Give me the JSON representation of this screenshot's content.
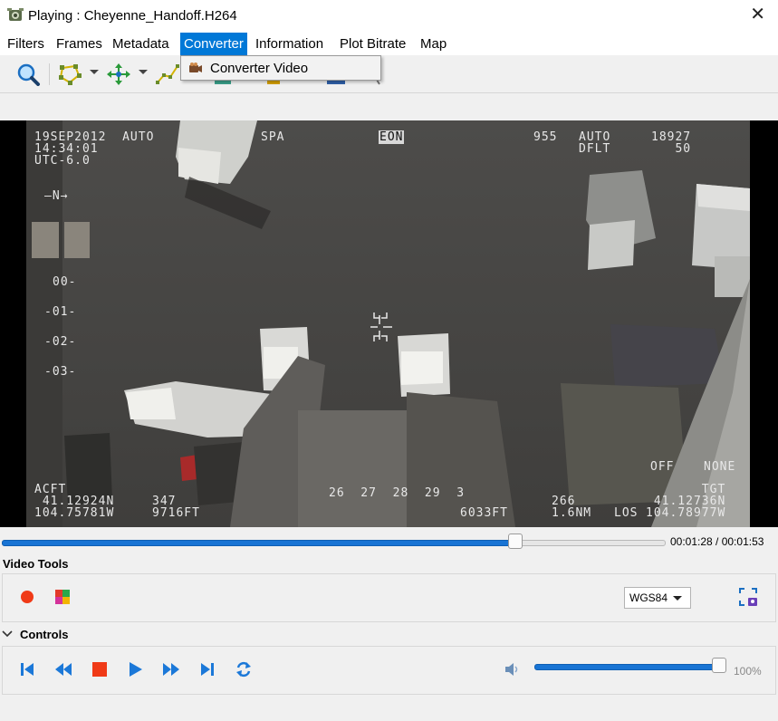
{
  "window": {
    "title": "Playing : Cheyenne_Handoff.H264",
    "close_glyph": "✕"
  },
  "menu": {
    "items": [
      "Filters",
      "Frames",
      "Metadata",
      "Converter",
      "Information",
      "Plot Bitrate",
      "Map"
    ],
    "active": "Converter"
  },
  "converter_menu": {
    "items": [
      {
        "label": "Converter Video",
        "icon": "camera-icon"
      }
    ]
  },
  "toolbar": {
    "icons": [
      "magnifier-icon",
      "polygon-icon",
      "move-cross-icon",
      "polyline-icon",
      "stamp-icon",
      "filter-icon",
      "gear-icon",
      "map-pin-icon"
    ]
  },
  "video": {
    "osd": {
      "top_left": "19SEP2012  AUTO\n14:34:01\nUTC-6.0",
      "spa": "SPA",
      "eon": "EON",
      "top_center": "955",
      "top_right_auto": "AUTO\nDFLT",
      "top_right_num": "18927\n50",
      "north": "—N→",
      "ladder": [
        "00-",
        "-01-",
        "-02-",
        "-03-"
      ],
      "bottom_left": "ACFT\n 41.12924N\n104.75781W",
      "altitude": "347\n9716FT",
      "heading_tape": "26  27  28  29  3",
      "range": "6033FT",
      "slant": "266\n1.6NM",
      "los": "LOS",
      "bottom_right": "TGT\n 41.12736N\n104.78977W",
      "off": "OFF",
      "none": "NONE"
    }
  },
  "seek": {
    "current": "00:01:28",
    "total": "00:01:53",
    "display": "00:01:28 / 00:01:53",
    "progress": 0.774
  },
  "video_tools": {
    "label": "Video Tools",
    "record_icon": "record-icon",
    "color_icon": "color-squares-icon",
    "coord_system": "WGS84",
    "capture_icon": "capture-icon"
  },
  "controls": {
    "label": "Controls",
    "buttons": [
      "skip-start-icon",
      "rewind-icon",
      "stop-icon",
      "play-icon",
      "fast-forward-icon",
      "skip-end-icon",
      "loop-icon"
    ],
    "volume_icon": "speaker-icon",
    "volume": "100%",
    "volume_level": 1.0
  },
  "colors": {
    "accent": "#1874d4",
    "menu_active": "#0078d7",
    "stop": "#f03a17",
    "record": "#f03a17"
  }
}
